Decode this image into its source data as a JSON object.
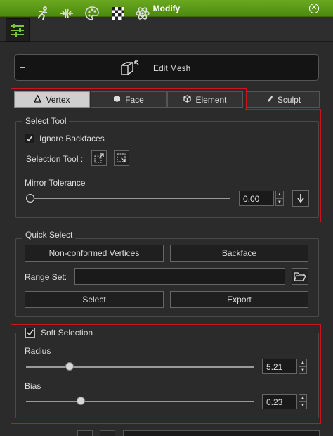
{
  "window": {
    "title": "Modify",
    "close_icon": "close-icon"
  },
  "toolbar": {
    "icons": [
      "sliders-icon",
      "pose-figure-icon",
      "morph-icon",
      "material-palette-icon",
      "checker-texture-icon",
      "atom-physics-icon"
    ]
  },
  "edit_mesh": {
    "collapse": "–",
    "label": "Edit Mesh"
  },
  "tabs": [
    {
      "label": "Vertex",
      "active": true
    },
    {
      "label": "Face",
      "active": false
    },
    {
      "label": "Element",
      "active": false
    },
    {
      "label": "Sculpt",
      "active": false
    }
  ],
  "select_tool": {
    "title": "Select Tool",
    "ignore_backfaces": {
      "label": "Ignore Backfaces",
      "checked": true
    },
    "selection_tool_label": "Selection Tool :",
    "mirror_tolerance": {
      "label": "Mirror Tolerance",
      "value": "0.00",
      "level": 0.0
    }
  },
  "quick_select": {
    "title": "Quick Select",
    "non_conformed_button": "Non-conformed Vertices",
    "backface_button": "Backface",
    "range_set_label": "Range Set:",
    "range_set_value": "",
    "select_button": "Select",
    "export_button": "Export"
  },
  "soft_selection": {
    "title": "Soft Selection",
    "checked": true,
    "radius": {
      "label": "Radius",
      "value": "5.21",
      "level": 0.19
    },
    "bias": {
      "label": "Bias",
      "value": "0.23",
      "level": 0.24
    }
  },
  "colors": {
    "titlebar": "#5a9a18",
    "highlight": "#c8161c",
    "active_tab": "#cfcfcf"
  }
}
